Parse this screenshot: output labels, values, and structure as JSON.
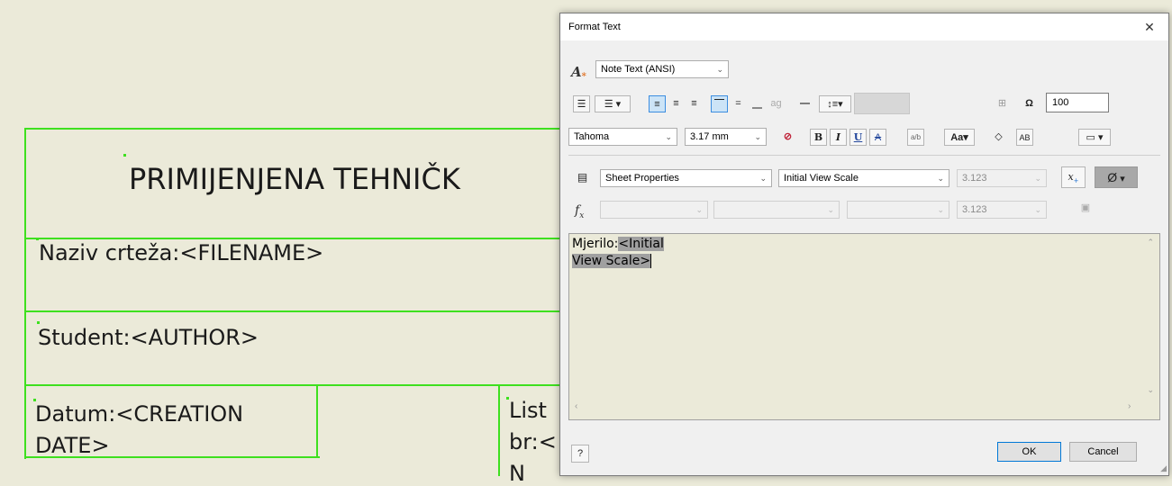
{
  "sheet": {
    "title_text": "PRIMIJENJENA TEHNIČK",
    "naziv_text": "Naziv crteža:<FILENAME>",
    "student_text": "Student:<AUTHOR>",
    "datum_line1": "Datum:<CREATION",
    "datum_line2": "DATE>",
    "list_line1": "List",
    "list_line2": "br:<",
    "list_line3": "N"
  },
  "dialog": {
    "title": "Format Text",
    "close_glyph": "✕",
    "style_select": "Note Text (ANSI)",
    "scale_value": "100",
    "font_select": "Tahoma",
    "size_select": "3.17 mm",
    "bold": "B",
    "italic": "I",
    "underline": "U",
    "strike": "A",
    "type_select": "Sheet Properties",
    "property_select": "Initial View Scale",
    "precision_select": "3.123",
    "symbol_glyph": "Ø",
    "fx_precision_select": "3.123",
    "editor": {
      "prefix": "Mjerilo:",
      "field_line1": "<Initial",
      "field_line2": "View Scale>"
    },
    "ok_label": "OK",
    "cancel_label": "Cancel",
    "help_glyph": "?"
  },
  "colors": {
    "sheet_background": "#ebead9",
    "border_lines": "#3ee01f",
    "selection": "#a0a0a0",
    "active_button": "#cce4f7"
  }
}
